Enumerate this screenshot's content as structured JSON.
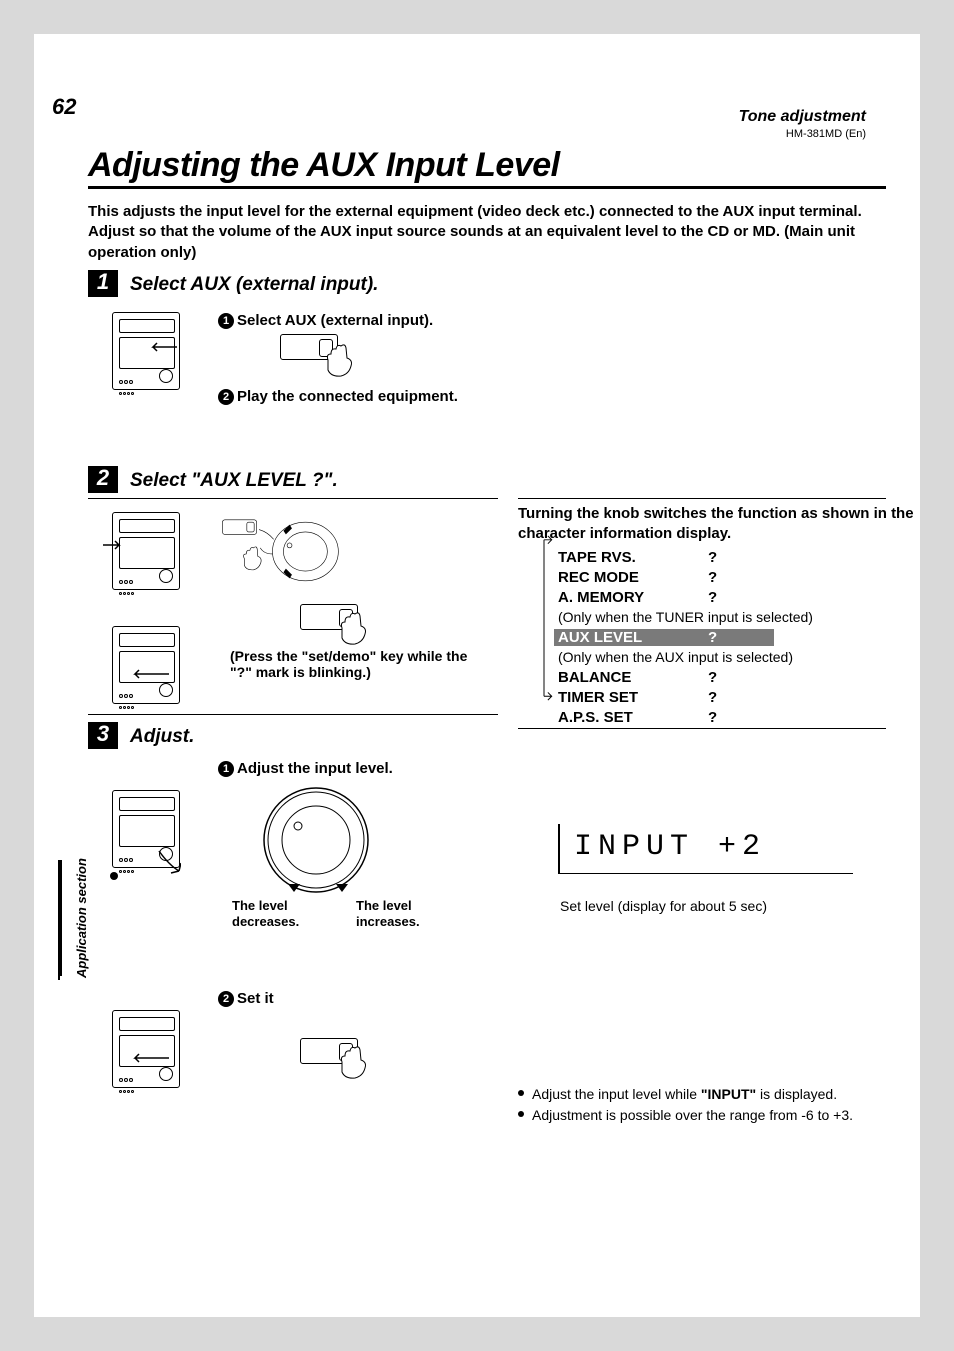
{
  "page_number": "62",
  "tone_header": "Tone adjustment",
  "model": "HM-381MD (En)",
  "title": "Adjusting the AUX Input Level",
  "intro": "This adjusts the input level for the external equipment (video deck etc.) connected to the AUX input terminal.  Adjust so that the volume of the AUX input source sounds at an equivalent level to the CD or MD. (Main unit operation only)",
  "section_tab": "Application section",
  "step1": {
    "num": "1",
    "title": "Select AUX (external input).",
    "sub1_n": "1",
    "sub1": "Select AUX (external input).",
    "sub2_n": "2",
    "sub2": "Play the connected equipment."
  },
  "step2": {
    "num": "2",
    "title": "Select \"AUX LEVEL ?\".",
    "note": "(Press the \"set/demo\" key while the \"?\" mark is blinking.)"
  },
  "step3": {
    "num": "3",
    "title": "Adjust.",
    "sub1_n": "1",
    "sub1": "Adjust the input level.",
    "dec": "The level decreases.",
    "inc": "The level increases.",
    "sub2_n": "2",
    "sub2": "Set it"
  },
  "func": {
    "head": "Turning the knob switches the function as shown in the character information display.",
    "rows": [
      {
        "name": "TAPE RVS.",
        "q": "?"
      },
      {
        "name": "REC MODE",
        "q": "?"
      },
      {
        "name": "A. MEMORY",
        "q": "?"
      }
    ],
    "note_tuner": "(Only when the TUNER input is selected)",
    "hl": {
      "name": "AUX LEVEL",
      "q": "?"
    },
    "note_aux": "(Only when the AUX input is selected)",
    "rows2": [
      {
        "name": "BALANCE",
        "q": "?"
      },
      {
        "name": "TIMER SET",
        "q": "?"
      },
      {
        "name": "A.P.S. SET",
        "q": "?"
      }
    ]
  },
  "display_text": "INPUT  +2",
  "display_caption": "Set level (display for about 5 sec)",
  "bullets": {
    "b1a": "Adjust the input level while ",
    "b1b": "\"INPUT\"",
    "b1c": " is displayed.",
    "b2": "Adjustment is possible over the range from -6 to +3."
  }
}
